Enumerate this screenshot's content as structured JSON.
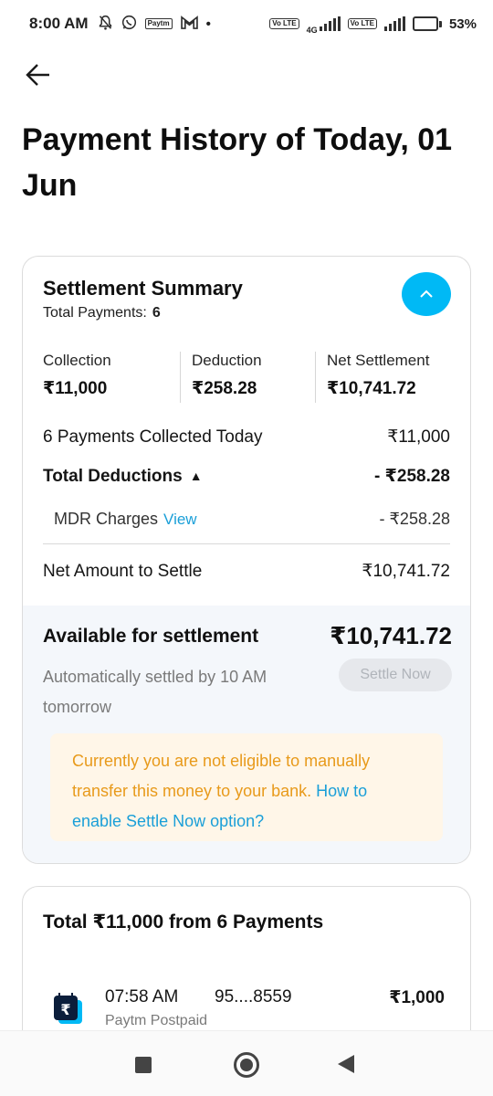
{
  "status_bar": {
    "time": "8:00 AM",
    "network": "4G",
    "volte": "Vo LTE",
    "battery": "53%",
    "battery_level": 0.53,
    "paytm_label": "Paytm"
  },
  "page_title": "Payment History of Today, 01 Jun",
  "summary": {
    "title": "Settlement Summary",
    "total_payments_label": "Total Payments:",
    "total_payments_value": "6",
    "metrics": [
      {
        "label": "Collection",
        "value": "₹11,000"
      },
      {
        "label": "Deduction",
        "value": "₹258.28"
      },
      {
        "label": "Net Settlement",
        "value": "₹10,741.72"
      }
    ],
    "collected_label": "6 Payments Collected Today",
    "collected_value": "₹11,000",
    "deductions_label": "Total Deductions",
    "deductions_value": "- ₹258.28",
    "mdr_label": "MDR Charges",
    "mdr_link": "View",
    "mdr_value": "- ₹258.28",
    "net_label": "Net Amount to Settle",
    "net_value": "₹10,741.72"
  },
  "available": {
    "title": "Available for settlement",
    "amount": "₹10,741.72",
    "note": "Automatically settled by 10 AM tomorrow",
    "settle_button": "Settle Now",
    "warning_text": "Currently you are not eligible to manually transfer this money to your bank.",
    "warning_link": "How to enable Settle Now option?"
  },
  "payments": {
    "title": "Total ₹11,000 from 6 Payments",
    "items": [
      {
        "time": "07:58 AM",
        "number": "95....8559",
        "amount": "₹1,000",
        "source": "Paytm Postpaid"
      }
    ]
  },
  "colors": {
    "accent": "#00b9f5",
    "link": "#1a9fd8",
    "warning_text": "#e89a1b",
    "warning_bg": "#fff6e8"
  }
}
